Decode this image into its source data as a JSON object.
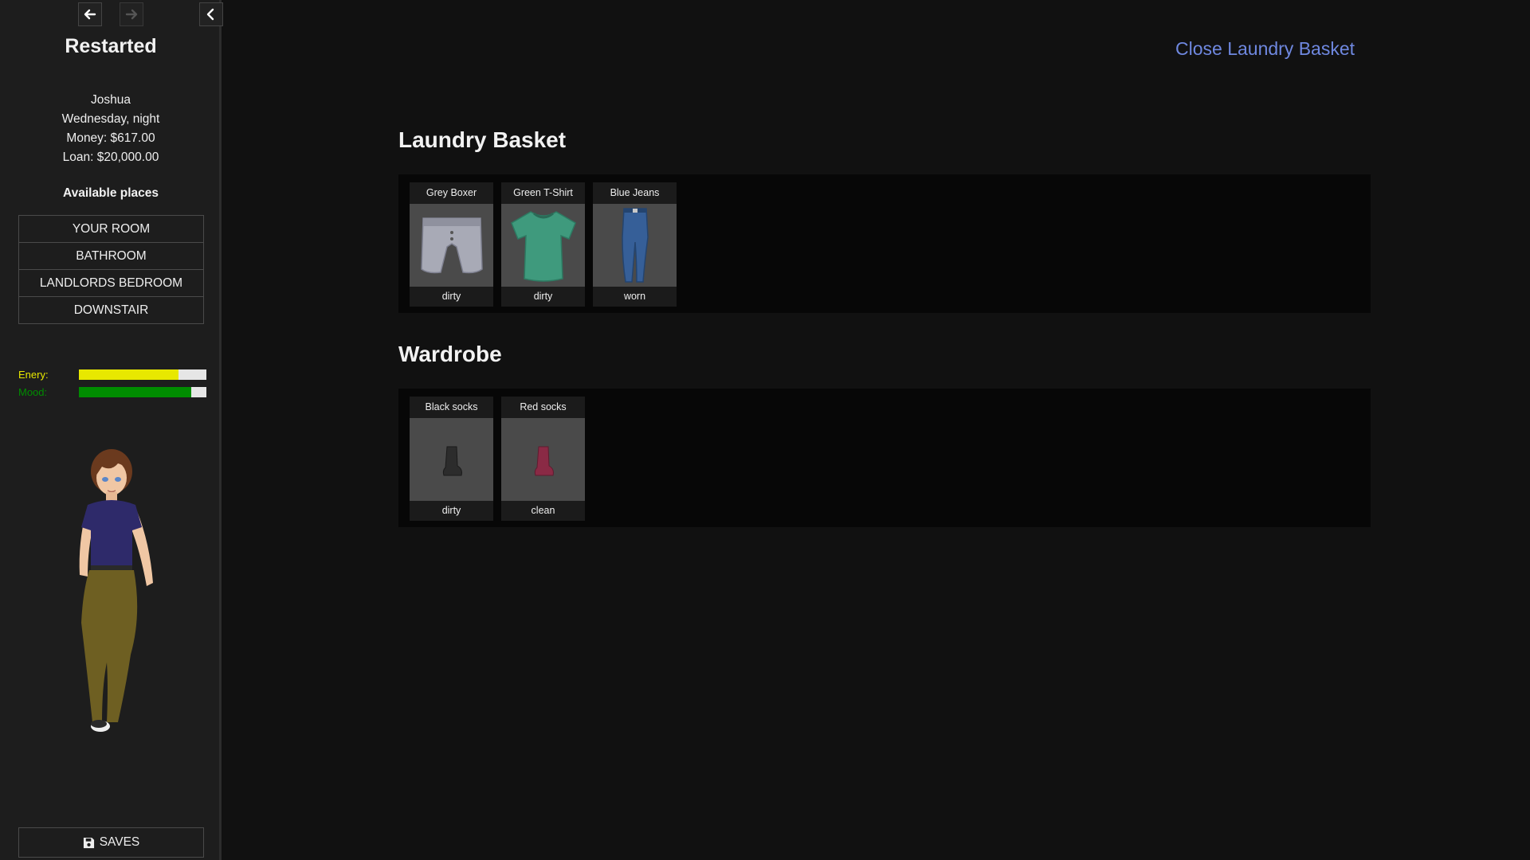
{
  "sidebar": {
    "title": "Restarted",
    "status": {
      "name": "Joshua",
      "time": "Wednesday, night",
      "money": "Money: $617.00",
      "loan": "Loan: $20,000.00"
    },
    "places_heading": "Available places",
    "places": [
      {
        "label": "YOUR ROOM"
      },
      {
        "label": "BATHROOM"
      },
      {
        "label": "LANDLORDS BEDROOM"
      },
      {
        "label": "DOWNSTAIR"
      }
    ],
    "meters": {
      "energy": {
        "label": "Enery:",
        "level": 0.78,
        "color": "#e8e800"
      },
      "mood": {
        "label": "Mood:",
        "level": 0.88,
        "color": "#008c00"
      }
    },
    "saves_label": "SAVES",
    "icons": {
      "back": "arrow-left-icon",
      "forward": "arrow-right-icon",
      "collapse": "chevron-left-icon",
      "saves": "floppy-disk-icon"
    }
  },
  "main": {
    "close_link": "Close Laundry Basket",
    "basket": {
      "title": "Laundry Basket",
      "items": [
        {
          "name": "Grey Boxer",
          "state": "dirty",
          "icon": "boxer-icon",
          "color": "#a8aab6"
        },
        {
          "name": "Green T-Shirt",
          "state": "dirty",
          "icon": "tshirt-icon",
          "color": "#3f9a7d"
        },
        {
          "name": "Blue Jeans",
          "state": "worn",
          "icon": "jeans-icon",
          "color": "#365f98"
        }
      ]
    },
    "wardrobe": {
      "title": "Wardrobe",
      "items": [
        {
          "name": "Black socks",
          "state": "dirty",
          "icon": "sock-icon",
          "color": "#2c2c2c"
        },
        {
          "name": "Red socks",
          "state": "clean",
          "icon": "sock-icon",
          "color": "#8a2a45"
        }
      ]
    }
  },
  "colors": {
    "background": "#111111",
    "sidebar": "#1d1d1d",
    "link": "#6f88e0",
    "panel": "#070707"
  }
}
